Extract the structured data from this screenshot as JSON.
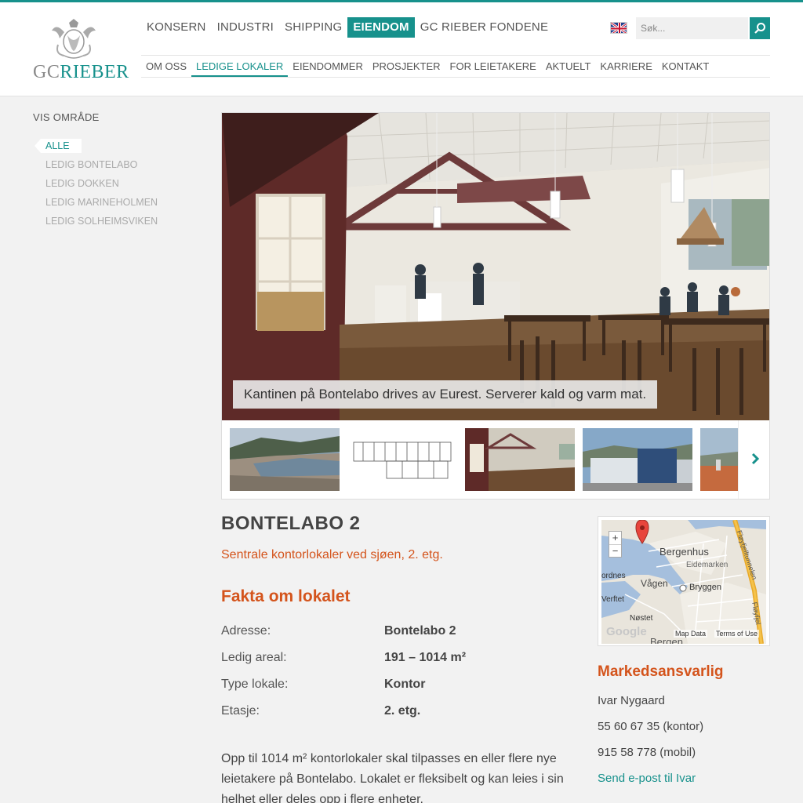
{
  "brand": {
    "logo_text_1": "GC",
    "logo_text_2": "RIEBER"
  },
  "main_nav": [
    {
      "label": "KONSERN"
    },
    {
      "label": "INDUSTRI"
    },
    {
      "label": "SHIPPING"
    },
    {
      "label": "EIENDOM",
      "active": true
    },
    {
      "label": "GC RIEBER FONDENE"
    }
  ],
  "search": {
    "placeholder": "Søk..."
  },
  "sub_nav": [
    {
      "label": "OM OSS"
    },
    {
      "label": "LEDIGE LOKALER",
      "active": true
    },
    {
      "label": "EIENDOMMER"
    },
    {
      "label": "PROSJEKTER"
    },
    {
      "label": "FOR LEIETAKERE"
    },
    {
      "label": "AKTUELT"
    },
    {
      "label": "KARRIERE"
    },
    {
      "label": "KONTAKT"
    }
  ],
  "sidebar": {
    "title": "VIS OMRÅDE",
    "items": [
      {
        "label": "ALLE",
        "active": true
      },
      {
        "label": "LEDIG BONTELABO"
      },
      {
        "label": "LEDIG DOKKEN"
      },
      {
        "label": "LEDIG MARINEHOLMEN"
      },
      {
        "label": "LEDIG SOLHEIMSVIKEN"
      }
    ]
  },
  "gallery": {
    "caption": "Kantinen på Bontelabo drives av Eurest. Serverer kald og varm mat.",
    "thumbnails": [
      {
        "icon": "city-aerial-thumbnail"
      },
      {
        "icon": "floor-plan-thumbnail"
      },
      {
        "icon": "canteen-thumbnail"
      },
      {
        "icon": "building-thumbnail"
      },
      {
        "icon": "harbor-thumbnail"
      }
    ]
  },
  "listing": {
    "title": "BONTELABO 2",
    "subtitle": "Sentrale kontorlokaler ved sjøen, 2. etg.",
    "facts_heading": "Fakta om lokalet",
    "facts": [
      {
        "label": "Adresse:",
        "value": "Bontelabo 2"
      },
      {
        "label": "Ledig areal:",
        "value": "191 – 1014 m²"
      },
      {
        "label": "Type lokale:",
        "value": "Kontor"
      },
      {
        "label": "Etasje:",
        "value": "2. etg."
      }
    ],
    "description": "Opp til 1014 m² kontorlokaler skal tilpasses en eller flere nye leietakere på Bontelabo. Lokalet er fleksibelt og kan leies i sin helhet eller deles opp i flere enheter."
  },
  "map": {
    "labels": {
      "bergenhus": "Bergenhus",
      "eidemarken": "Eidemarken",
      "vagen": "Vågen",
      "bryggen": "Bryggen",
      "nordnes": "ordnes",
      "verftet": "Verftet",
      "nostet": "Nøstet",
      "bergen": "Bergen",
      "tunnel": "Fløyfjelltunnelen",
      "tunnel2": "Fløyfjel",
      "google": "Google",
      "map_data": "Map Data",
      "terms": "Terms of Use"
    },
    "zoom_in": "+",
    "zoom_out": "−"
  },
  "contact": {
    "heading": "Markedsansvarlig",
    "name": "Ivar Nygaard",
    "phone_office": "55 60 67 35 (kontor)",
    "phone_mobile": "915 58 778 (mobil)",
    "email_link": "Send e-post til Ivar"
  },
  "colors": {
    "teal": "#17918c",
    "orange": "#d4541c"
  }
}
